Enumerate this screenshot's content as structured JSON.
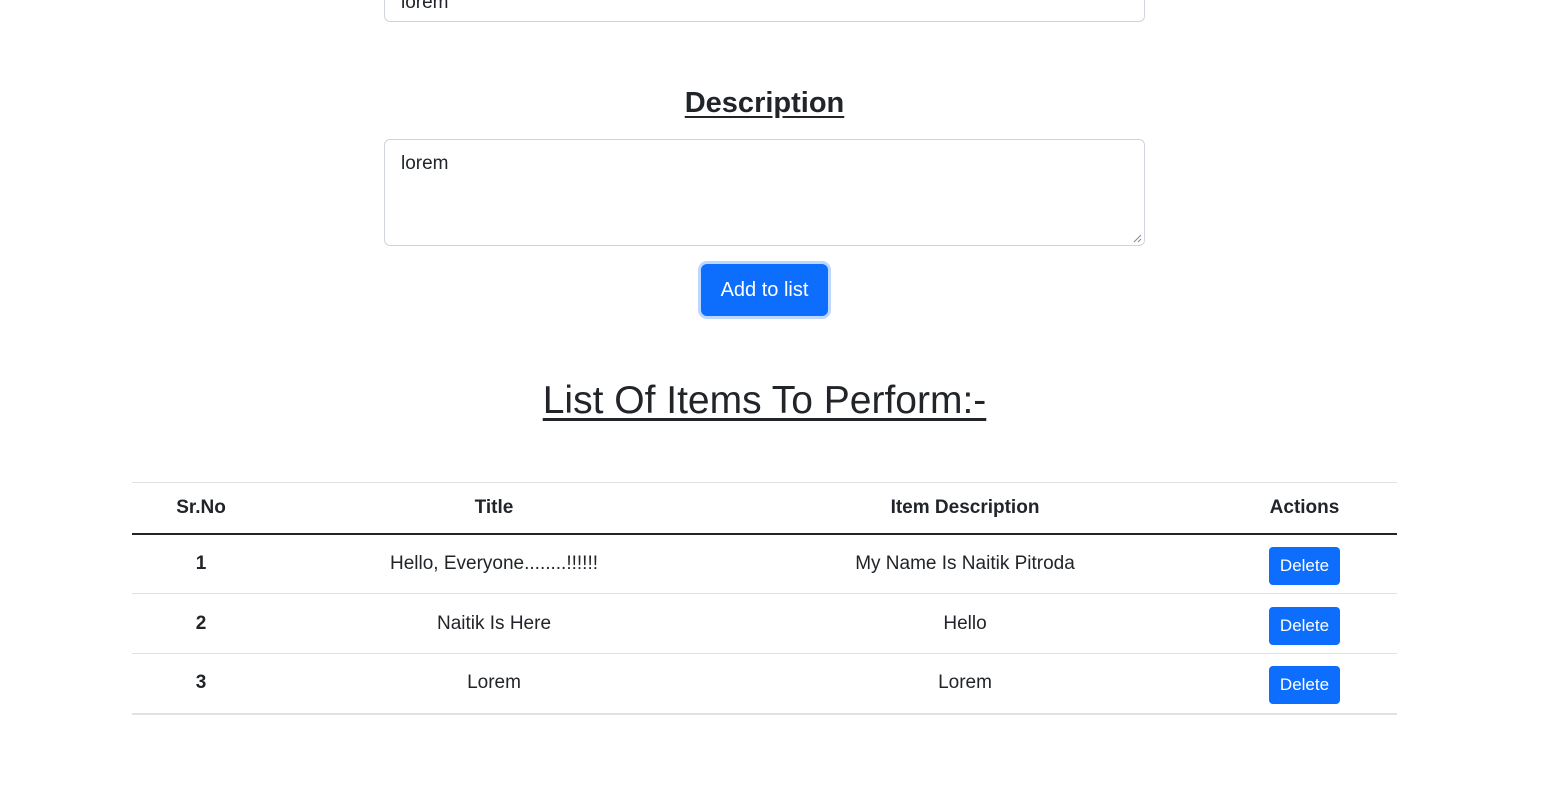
{
  "form": {
    "title_value": "lorem",
    "description_heading": "Description",
    "description_value": "lorem",
    "add_button_label": "Add to list"
  },
  "list": {
    "heading": "List Of Items To Perform:-",
    "columns": [
      "Sr.No",
      "Title",
      "Item Description",
      "Actions"
    ],
    "rows": [
      {
        "sr": "1",
        "title": "Hello, Everyone........!!!!!!",
        "description": "My Name Is Naitik Pitroda",
        "action": "Delete"
      },
      {
        "sr": "2",
        "title": "Naitik Is Here",
        "description": "Hello",
        "action": "Delete"
      },
      {
        "sr": "3",
        "title": "Lorem",
        "description": "Lorem",
        "action": "Delete"
      }
    ]
  },
  "colors": {
    "primary": "#0d6efd",
    "text": "#212529",
    "border": "#dee2e6"
  }
}
